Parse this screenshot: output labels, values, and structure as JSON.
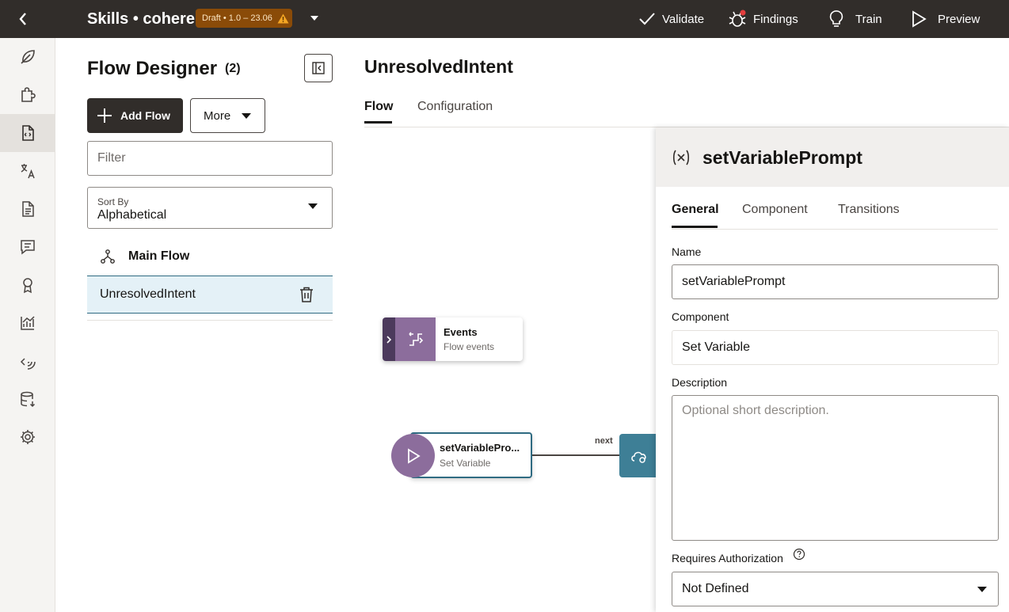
{
  "topbar": {
    "app_title": "Skills • cohere",
    "badge": "Draft • 1.0 – 23.06",
    "actions": {
      "validate": "Validate",
      "findings": "Findings",
      "train": "Train",
      "preview": "Preview"
    }
  },
  "rail": {
    "icons": [
      "feather-icon",
      "puzzle-icon",
      "flow-file-icon",
      "translate-icon",
      "document-icon",
      "chat-icon",
      "award-icon",
      "analytics-icon",
      "api-icon",
      "database-icon",
      "settings-icon"
    ],
    "active_index": 2
  },
  "flow_designer": {
    "title": "Flow Designer",
    "count": "(2)",
    "add_flow_label": "Add Flow",
    "more_label": "More",
    "filter_placeholder": "Filter",
    "sort_label": "Sort By",
    "sort_value": "Alphabetical",
    "flows": [
      {
        "label": "Main Flow"
      },
      {
        "label": "UnresolvedIntent",
        "selected": true
      }
    ]
  },
  "main": {
    "title": "UnresolvedIntent",
    "tabs": [
      "Flow",
      "Configuration"
    ],
    "active_tab": "Flow"
  },
  "canvas": {
    "events_node": {
      "title": "Events",
      "subtitle": "Flow events"
    },
    "state_node": {
      "title": "setVariablePro...",
      "subtitle": "Set Variable"
    },
    "edge_label": "next"
  },
  "properties": {
    "title": "setVariablePrompt",
    "tabs": [
      "General",
      "Component",
      "Transitions"
    ],
    "active_tab": "General",
    "name_label": "Name",
    "name_value": "setVariablePrompt",
    "component_label": "Component",
    "component_value": "Set Variable",
    "description_label": "Description",
    "description_placeholder": "Optional short description.",
    "requires_auth_label": "Requires Authorization",
    "requires_auth_value": "Not Defined"
  },
  "colors": {
    "topbar": "#312d2a",
    "badge": "#8a4b08",
    "accent_teal": "#2f6b82",
    "node_purple": "#8c6d9c"
  }
}
